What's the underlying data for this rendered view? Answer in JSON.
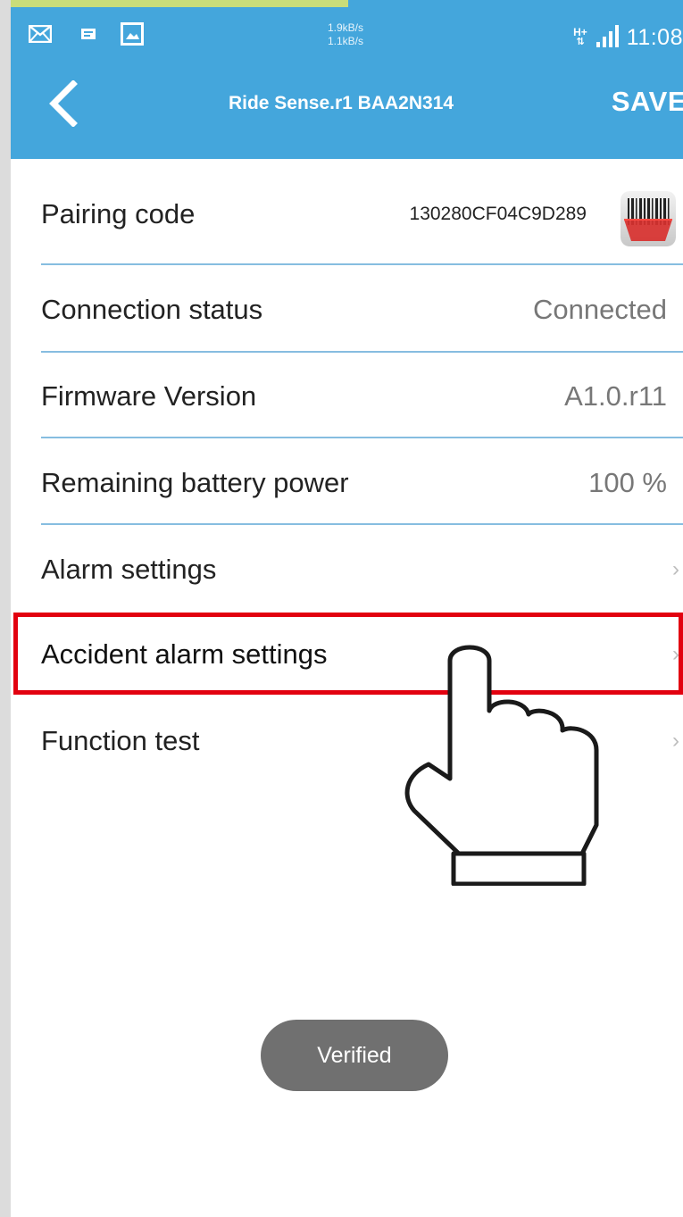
{
  "status_bar": {
    "net_up": "1.9kB/s",
    "net_down": "1.1kB/s",
    "network_type": "H+",
    "time": "11:08",
    "icons": [
      "mail-icon",
      "message-icon",
      "image-icon",
      "signal-icon"
    ]
  },
  "toolbar": {
    "back_icon": "chevron-left-icon",
    "title": "Ride Sense.r1 BAA2N314",
    "save_label": "SAVE"
  },
  "rows": {
    "pairing": {
      "label": "Pairing code",
      "value": "130280CF04C9D289",
      "icon": "barcode-scan-icon"
    },
    "connection": {
      "label": "Connection status",
      "value": "Connected"
    },
    "firmware": {
      "label": "Firmware Version",
      "value": "A1.0.r11"
    },
    "battery": {
      "label": "Remaining battery power",
      "value": "100 %"
    },
    "alarm": {
      "label": "Alarm settings",
      "chevron": "›"
    },
    "accident": {
      "label": "Accident alarm settings",
      "chevron": "›"
    },
    "function_test": {
      "label": "Function test",
      "chevron": "›"
    }
  },
  "toast": {
    "text": "Verified"
  },
  "colors": {
    "appbar": "#44a6dc",
    "divider": "#86bde0",
    "highlight": "#e2000f",
    "toast": "#707070"
  },
  "annotations": {
    "pointer_icon": "pointing-hand-icon",
    "highlight_target": "accident-alarm-settings"
  }
}
